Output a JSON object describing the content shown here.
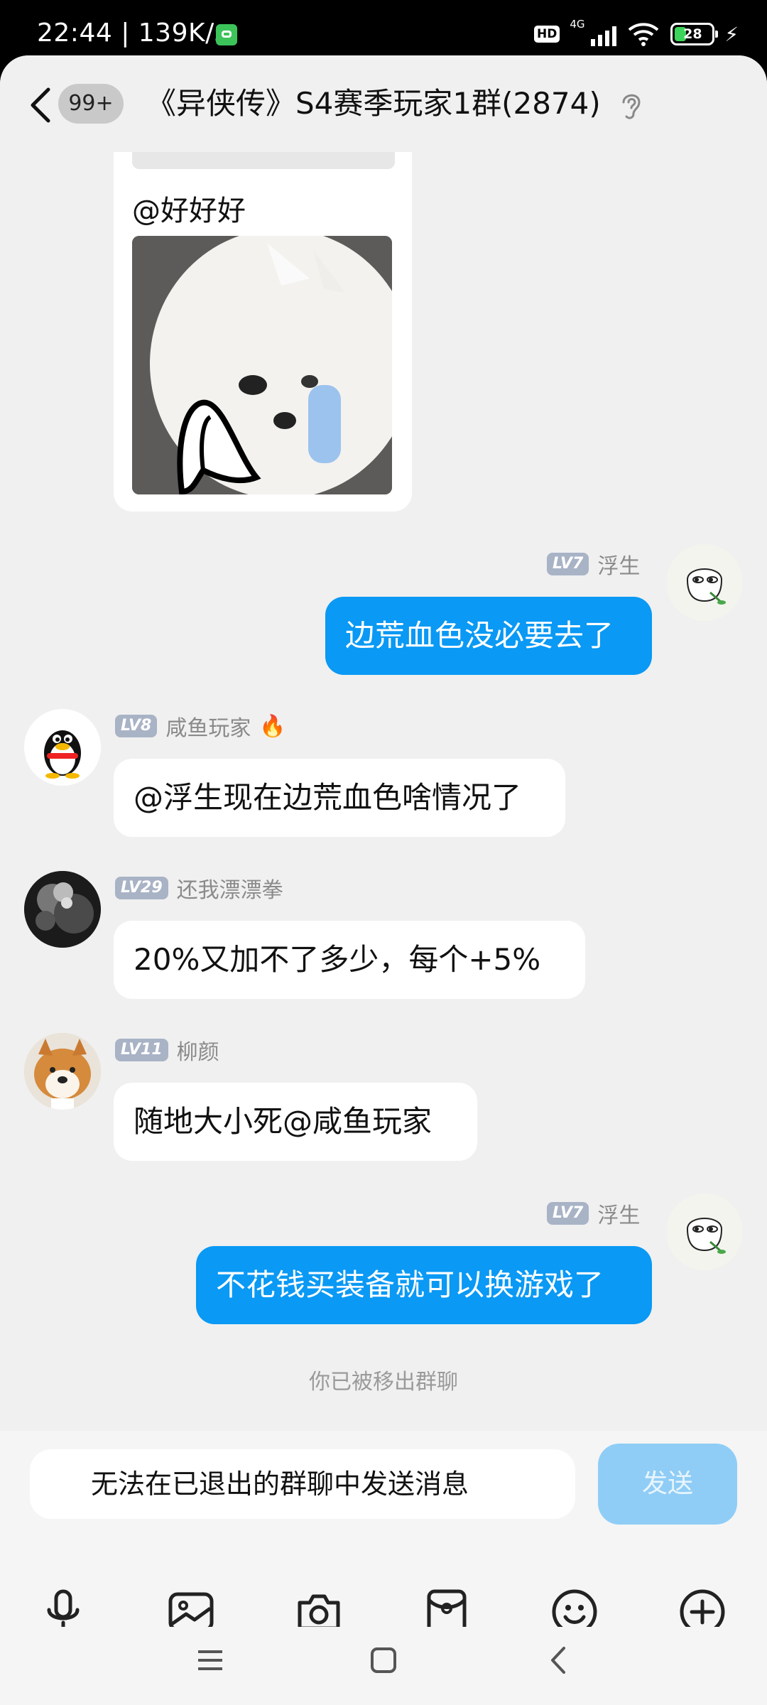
{
  "status_bar": {
    "time": "22:44",
    "net_speed": "139K/s",
    "hd": "HD",
    "network": "4G",
    "battery": "28"
  },
  "header": {
    "unread_badge": "99+",
    "title": "《异侠传》S4赛季玩家1群(2874)",
    "icons": [
      "back-arrow",
      "ear"
    ]
  },
  "messages": [
    {
      "type": "image_card",
      "mention": "@好好好"
    },
    {
      "side": "out",
      "level": "LV7",
      "sender": "浮生",
      "text": "边荒血色没必要去了"
    },
    {
      "side": "in",
      "level": "LV8",
      "sender": "咸鱼玩家",
      "text": "@浮生现在边荒血色啥情况了",
      "flame": true
    },
    {
      "side": "in",
      "level": "LV29",
      "sender": "还我漂漂拳",
      "text": "20%又加不了多少，每个+5%"
    },
    {
      "side": "in",
      "level": "LV11",
      "sender": "柳颜",
      "text": "随地大小死@咸鱼玩家"
    },
    {
      "side": "out",
      "level": "LV7",
      "sender": "浮生",
      "text": "不花钱买装备就可以换游戏了"
    }
  ],
  "system_notice": "你已被移出群聊",
  "input": {
    "placeholder": "无法在已退出的群聊中发送消息",
    "send_label": "发送"
  },
  "toolbar": [
    "microphone",
    "image",
    "camera",
    "red-packet",
    "emoji",
    "plus"
  ],
  "nav": [
    "menu",
    "home",
    "back"
  ],
  "colors": {
    "accent": "#0a99f4",
    "bg": "#f0f0f0",
    "level": "#a9b3c6"
  }
}
